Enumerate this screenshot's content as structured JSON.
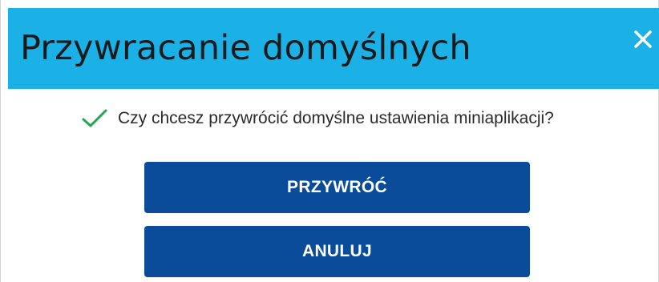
{
  "dialog": {
    "title": "Przywracanie domyślnych",
    "close_icon": "close-icon",
    "message": "Czy chcesz przywrócić domyślne ustawienia miniaplikacji?",
    "message_icon": "checkmark-icon",
    "buttons": {
      "restore_label": "PRZYWRÓĆ",
      "cancel_label": "ANULUJ"
    }
  },
  "colors": {
    "header_background": "#1bb0e6",
    "button_background": "#0a4c99",
    "checkmark": "#1fa84f",
    "close_icon": "#ffffff"
  }
}
